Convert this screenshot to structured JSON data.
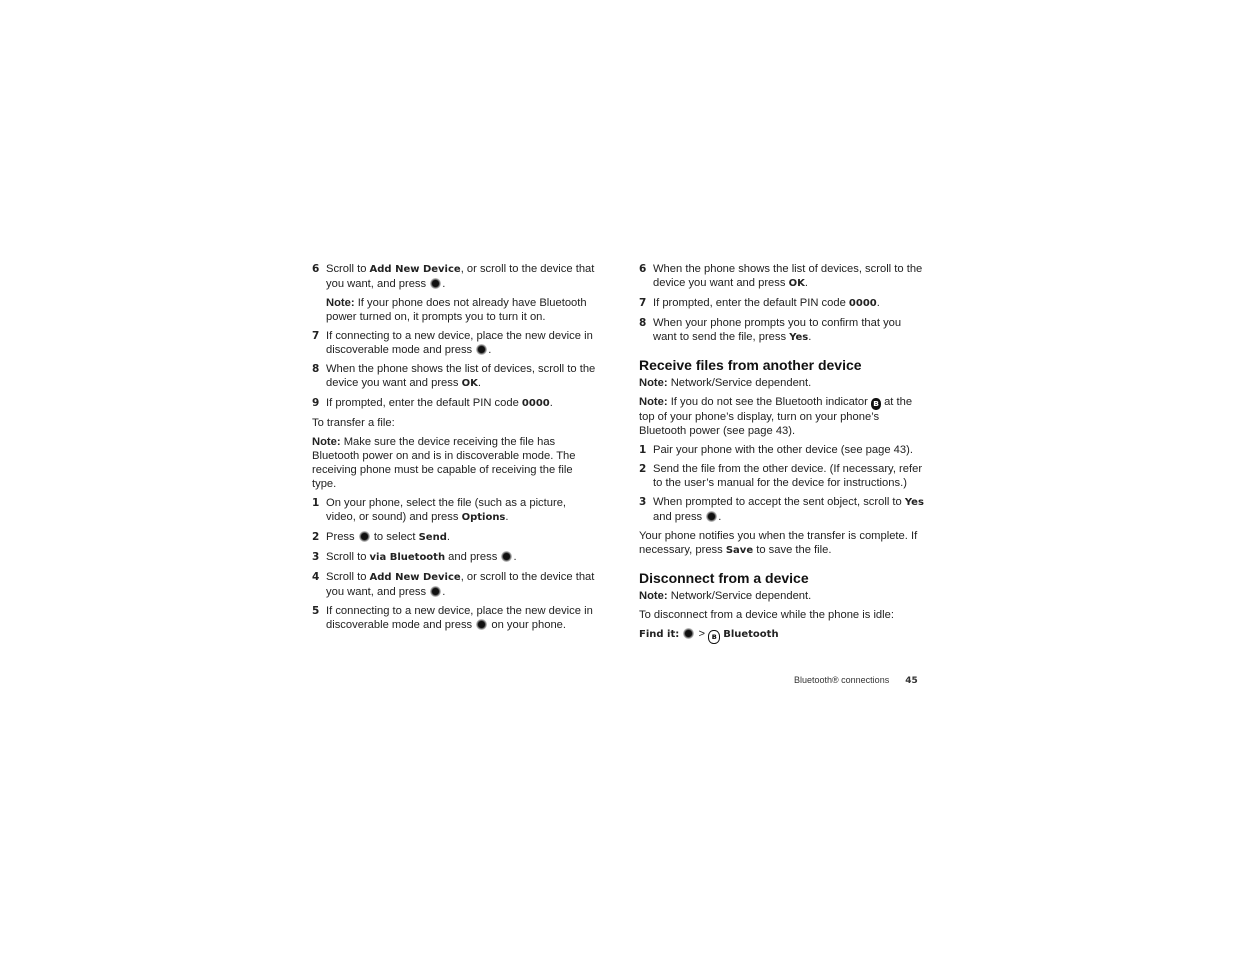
{
  "left": {
    "s6": {
      "num": "6",
      "a": "Scroll to ",
      "b": "Add New Device",
      "c": ", or scroll to the device that you want, and press ",
      "d": "."
    },
    "note1": {
      "label": "Note:",
      "text": " If your phone does not already have Bluetooth power turned on, it prompts you to turn it on."
    },
    "s7": {
      "num": "7",
      "a": "If connecting to a new device, place the new device in discoverable mode and press ",
      "d": "."
    },
    "s8": {
      "num": "8",
      "a": "When the phone shows the list of devices, scroll to the device you want and press ",
      "b": "OK",
      "d": "."
    },
    "s9": {
      "num": "9",
      "a": "If prompted, enter the default PIN code ",
      "b": "0000",
      "d": "."
    },
    "transfer": "To transfer a file:",
    "note2": {
      "label": "Note:",
      "text": " Make sure the device receiving the file has Bluetooth power on and is in discoverable mode. The receiving phone must be capable of receiving the file type."
    },
    "t1": {
      "num": "1",
      "a": "On your phone, select the file (such as a picture, video, or sound) and press ",
      "b": "Options",
      "d": "."
    },
    "t2": {
      "num": "2",
      "a": "Press ",
      "c": " to select ",
      "b": "Send",
      "d": "."
    },
    "t3": {
      "num": "3",
      "a": "Scroll to ",
      "b": "via Bluetooth",
      "c": " and press ",
      "d": "."
    },
    "t4": {
      "num": "4",
      "a": "Scroll to ",
      "b": "Add New Device",
      "c": ", or scroll to the device that you want, and press ",
      "d": "."
    },
    "t5": {
      "num": "5",
      "a": "If connecting to a new device, place the new device in discoverable mode and press ",
      "c": " on your phone."
    }
  },
  "right": {
    "s6": {
      "num": "6",
      "a": "When the phone shows the list of devices, scroll to the device you want and press ",
      "b": "OK",
      "d": "."
    },
    "s7": {
      "num": "7",
      "a": "If prompted, enter the default PIN code ",
      "b": "0000",
      "d": "."
    },
    "s8": {
      "num": "8",
      "a": "When your phone prompts you to confirm that you want to send the file, press ",
      "b": "Yes",
      "d": "."
    },
    "receive": {
      "heading": "Receive files from another device",
      "note1": {
        "label": "Note:",
        "text": " Network/Service dependent."
      },
      "note2": {
        "label": "Note:",
        "a": " If you do not see the Bluetooth indicator ",
        "c": " at the top of your phone’s display, turn on your phone’s Bluetooth power (see page 43)."
      },
      "r1": {
        "num": "1",
        "a": "Pair your phone with the other device (see page 43)."
      },
      "r2": {
        "num": "2",
        "a": "Send the file from the other device. (If necessary, refer to the user’s manual for the device for instructions.)"
      },
      "r3": {
        "num": "3",
        "a": "When prompted to accept the sent object, scroll to ",
        "b": "Yes",
        "c": " and press ",
        "d": "."
      },
      "complete": {
        "a": "Your phone notifies you when the transfer is complete. If necessary, press ",
        "b": "Save",
        "c": " to save the file."
      }
    },
    "disconnect": {
      "heading": "Disconnect from a device",
      "note1": {
        "label": "Note:",
        "text": " Network/Service dependent."
      },
      "idle": "To disconnect from a device while the phone is idle:",
      "findit": {
        "label": "Find it:",
        "sep": " > ",
        "target": "Bluetooth"
      }
    }
  },
  "icons": {
    "bt": "ʙ"
  },
  "footer": {
    "section": "Bluetooth® connections",
    "page": "45"
  }
}
